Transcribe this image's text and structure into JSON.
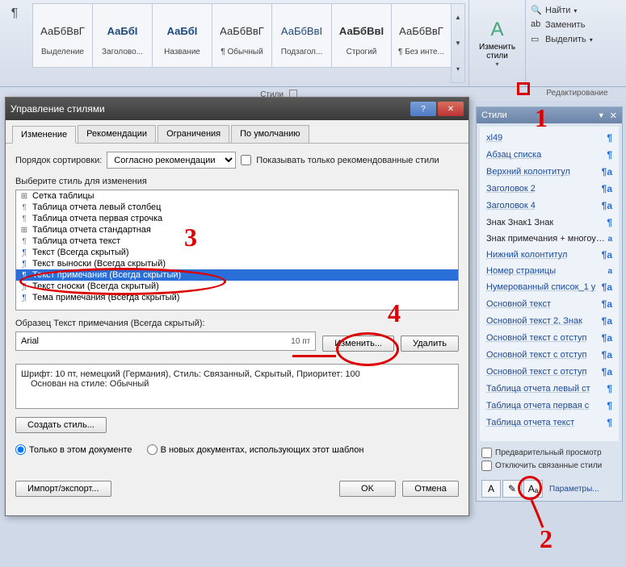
{
  "ribbon": {
    "styles": [
      {
        "preview": "АаБбВвГ",
        "label": "Выделение",
        "cls": ""
      },
      {
        "preview": "АаБбІ",
        "label": "Заголово...",
        "cls": "bold blue"
      },
      {
        "preview": "АаБбІ",
        "label": "Название",
        "cls": "bold blue"
      },
      {
        "preview": "АаБбВвГ",
        "label": "¶ Обычный",
        "cls": ""
      },
      {
        "preview": "АаБбВвІ",
        "label": "Подзагол...",
        "cls": "blue"
      },
      {
        "preview": "АаБбВвI",
        "label": "Строгий",
        "cls": "bold"
      },
      {
        "preview": "АаБбВвГ",
        "label": "¶ Без инте...",
        "cls": ""
      }
    ],
    "change_styles": "Изменить стили",
    "find": "Найти",
    "replace": "Заменить",
    "select": "Выделить",
    "group_styles": "Стили",
    "group_editing": "Редактирование"
  },
  "dialog": {
    "title": "Управление стилями",
    "tabs": [
      "Изменение",
      "Рекомендации",
      "Ограничения",
      "По умолчанию"
    ],
    "sort_label": "Порядок сортировки:",
    "sort_value": "Согласно рекомендации",
    "show_rec": "Показывать только рекомендованные стили",
    "choose_label": "Выберите стиль для изменения",
    "list": [
      {
        "icon": "grid",
        "text": "Сетка таблицы"
      },
      {
        "icon": "para",
        "text": "Таблица отчета левый столбец"
      },
      {
        "icon": "para",
        "text": "Таблица отчета первая строчка"
      },
      {
        "icon": "grid",
        "text": "Таблица отчета стандартная"
      },
      {
        "icon": "para",
        "text": "Таблица отчета текст"
      },
      {
        "icon": "paraU",
        "text": "Текст  (Всегда скрытый)"
      },
      {
        "icon": "paraU",
        "text": "Текст выноски  (Всегда скрытый)"
      },
      {
        "icon": "paraU",
        "text": "Текст примечания  (Всегда скрытый)",
        "selected": true
      },
      {
        "icon": "paraU",
        "text": "Текст сноски  (Всегда скрытый)"
      },
      {
        "icon": "paraU",
        "text": "Тема примечания  (Всегда скрытый)"
      }
    ],
    "sample_label": "Образец Текст примечания  (Всегда скрытый):",
    "sample_font": "Arial",
    "sample_pt": "10 пт",
    "modify_btn": "Изменить...",
    "delete_btn": "Удалить",
    "desc_line1": "Шрифт: 10 пт, немецкий (Германия), Стиль: Связанный, Скрытый, Приоритет: 100",
    "desc_line2": "Основан на стиле: Обычный",
    "create_style": "Создать стиль...",
    "radio_this": "Только в этом документе",
    "radio_new": "В новых документах, использующих этот шаблон",
    "import_export": "Импорт/экспорт...",
    "ok": "OK",
    "cancel": "Отмена"
  },
  "pane": {
    "title": "Стили",
    "items": [
      {
        "name": "xl49",
        "type": "¶"
      },
      {
        "name": "Абзац списка",
        "type": "¶"
      },
      {
        "name": "Верхний колонтитул",
        "type": "¶a"
      },
      {
        "name": "Заголовок 2",
        "type": "¶a"
      },
      {
        "name": "Заголовок 4",
        "type": "¶a"
      },
      {
        "name": "Знак Знак1 Знак",
        "type": "¶",
        "plain": true
      },
      {
        "name": "Знак примечания + многоуровневый, Слева:",
        "type": "a",
        "plain": true
      },
      {
        "name": "Нижний колонтитул",
        "type": "¶a"
      },
      {
        "name": "Номер страницы",
        "type": "a"
      },
      {
        "name": "Нумерованный список_1 у",
        "type": "¶a"
      },
      {
        "name": "Основной текст",
        "type": "¶a"
      },
      {
        "name": "Основной текст 2, Знак",
        "type": "¶a"
      },
      {
        "name": "Основной текст с отступ",
        "type": "¶a"
      },
      {
        "name": "Основной текст с отступ",
        "type": "¶a"
      },
      {
        "name": "Основной текст с отступ",
        "type": "¶a"
      },
      {
        "name": "Таблица отчета левый ст",
        "type": "¶"
      },
      {
        "name": "Таблица отчета первая с",
        "type": "¶"
      },
      {
        "name": "Таблица отчета текст",
        "type": "¶"
      }
    ],
    "preview_chk": "Предварительный просмотр",
    "disable_chk": "Отключить связанные стили",
    "params": "Параметры..."
  }
}
